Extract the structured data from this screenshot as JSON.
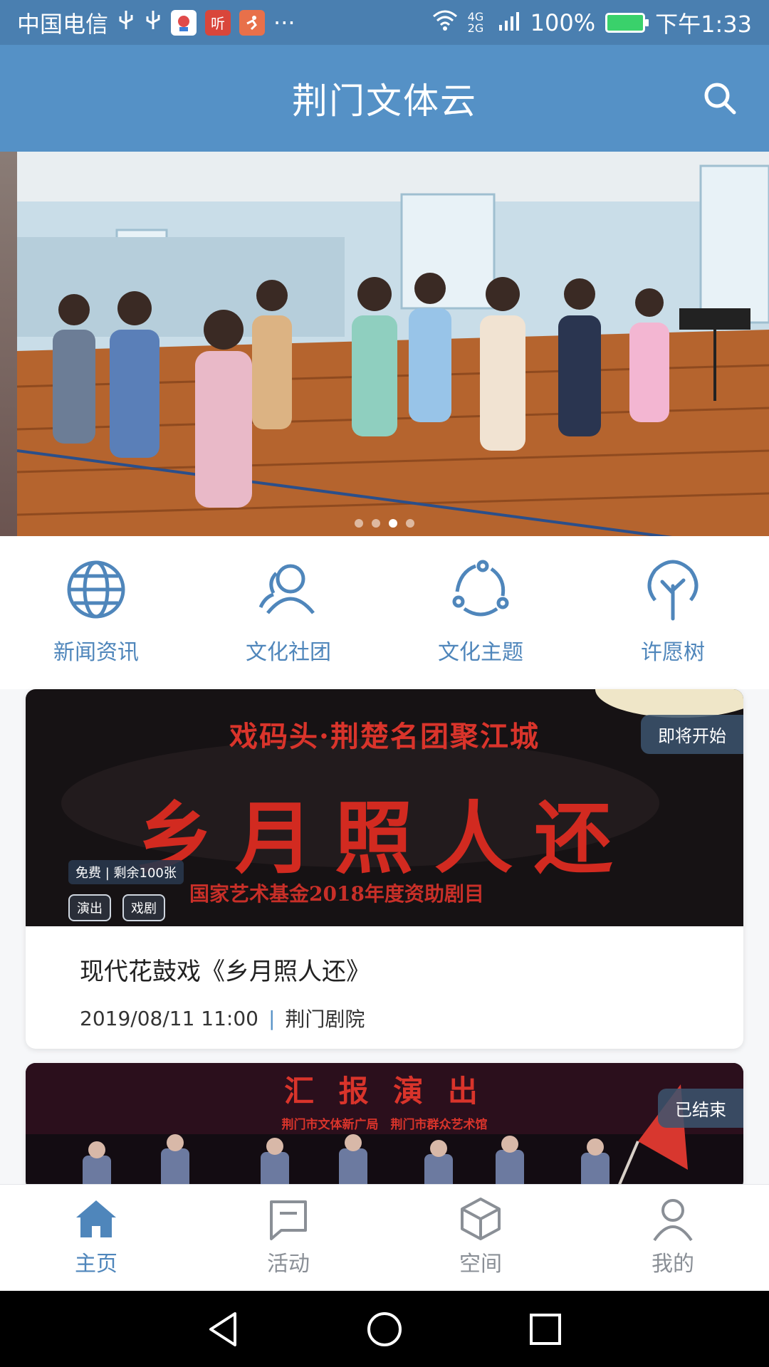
{
  "status_bar": {
    "carrier": "中国电信",
    "notification_icons": [
      "usb-icon",
      "usb-icon",
      "app-icon",
      "app-icon",
      "app-icon"
    ],
    "more": "···",
    "network": "4G 2G",
    "battery": "100%",
    "time": "下午1:33"
  },
  "app_bar": {
    "title": "荆门文体云"
  },
  "banner": {
    "slide_count": 4,
    "active_slide": 3
  },
  "quick_nav": [
    {
      "label": "新闻资讯",
      "icon": "globe-icon"
    },
    {
      "label": "文化社团",
      "icon": "group-icon"
    },
    {
      "label": "文化主题",
      "icon": "cycle-icon"
    },
    {
      "label": "许愿树",
      "icon": "tree-icon"
    }
  ],
  "events": [
    {
      "status": "即将开始",
      "poster_line1": "戏码头·荆楚名团聚江城",
      "poster_line2": "乡月照人还",
      "poster_line3": "国家艺术基金2018年度资助剧目",
      "ticket": "免费 | 剩余100张",
      "tags": [
        "演出",
        "戏剧"
      ],
      "name": "现代花鼓戏《乡月照人还》",
      "datetime": "2019/08/11 11:00",
      "separator": "|",
      "venue": "荆门剧院"
    },
    {
      "status": "已结束",
      "poster_line1": "汇 报 演 出",
      "poster_line2": "荆门市文体新广局　荆门市群众艺术馆"
    }
  ],
  "tab_bar": [
    {
      "label": "主页",
      "icon": "home-icon",
      "active": true
    },
    {
      "label": "活动",
      "icon": "message-icon",
      "active": false
    },
    {
      "label": "空间",
      "icon": "cube-icon",
      "active": false
    },
    {
      "label": "我的",
      "icon": "user-icon",
      "active": false
    }
  ],
  "colors": {
    "primary": "#5591c6",
    "status_bar": "#4a7fb0",
    "accent_text": "#4f86bb",
    "inactive_tab": "#8a8f96"
  }
}
